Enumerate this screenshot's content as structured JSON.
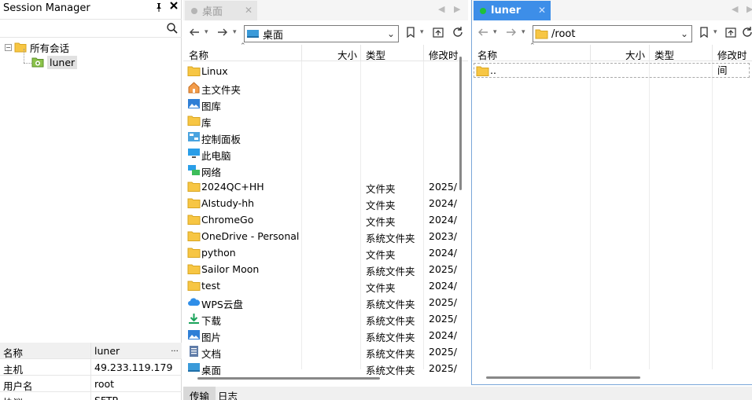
{
  "session_manager": {
    "title": "Session Manager",
    "pin_glyph": "📌",
    "close_glyph": "✕",
    "search_placeholder": "",
    "tree": {
      "root_label": "所有会话",
      "child_label": "luner"
    },
    "properties": [
      {
        "key": "名称",
        "value": "luner"
      },
      {
        "key": "主机",
        "value": "49.233.119.179"
      },
      {
        "key": "用户名",
        "value": "root"
      },
      {
        "key": "协议",
        "value": "SFTP"
      }
    ],
    "prop_more": "..."
  },
  "left_pane": {
    "tab_label": "桌面",
    "address": "桌面",
    "columns": {
      "name": "名称",
      "size": "大小",
      "type": "类型",
      "modified": "修改时"
    },
    "rows": [
      {
        "name": "Linux",
        "type": "",
        "mod": "",
        "icon": "folder-icon"
      },
      {
        "name": "主文件夹",
        "type": "",
        "mod": "",
        "icon": "home-icon"
      },
      {
        "name": "图库",
        "type": "",
        "mod": "",
        "icon": "gallery-icon"
      },
      {
        "name": "库",
        "type": "",
        "mod": "",
        "icon": "folder-icon"
      },
      {
        "name": "控制面板",
        "type": "",
        "mod": "",
        "icon": "control-panel-icon"
      },
      {
        "name": "此电脑",
        "type": "",
        "mod": "",
        "icon": "computer-icon"
      },
      {
        "name": "网络",
        "type": "",
        "mod": "",
        "icon": "network-icon"
      },
      {
        "name": "2024QC+HH",
        "type": "文件夹",
        "mod": "2025/",
        "icon": "folder-icon"
      },
      {
        "name": "AIstudy-hh",
        "type": "文件夹",
        "mod": "2024/",
        "icon": "folder-icon"
      },
      {
        "name": "ChromeGo",
        "type": "文件夹",
        "mod": "2024/",
        "icon": "folder-icon"
      },
      {
        "name": "OneDrive - Personal",
        "type": "系统文件夹",
        "mod": "2023/",
        "icon": "folder-icon"
      },
      {
        "name": "python",
        "type": "文件夹",
        "mod": "2024/",
        "icon": "folder-icon"
      },
      {
        "name": "Sailor Moon",
        "type": "系统文件夹",
        "mod": "2025/",
        "icon": "folder-icon"
      },
      {
        "name": "test",
        "type": "文件夹",
        "mod": "2024/",
        "icon": "folder-icon"
      },
      {
        "name": "WPS云盘",
        "type": "系统文件夹",
        "mod": "2025/",
        "icon": "cloud-icon"
      },
      {
        "name": "下载",
        "type": "系统文件夹",
        "mod": "2025/",
        "icon": "download-icon"
      },
      {
        "name": "图片",
        "type": "系统文件夹",
        "mod": "2024/",
        "icon": "picture-icon"
      },
      {
        "name": "文档",
        "type": "系统文件夹",
        "mod": "2025/",
        "icon": "document-icon"
      },
      {
        "name": "桌面",
        "type": "系统文件夹",
        "mod": "2025/",
        "icon": "desktop-icon"
      }
    ]
  },
  "right_pane": {
    "tab_label": "luner",
    "address": "/root",
    "columns": {
      "name": "名称",
      "size": "大小",
      "type": "类型",
      "modified": "修改时间"
    },
    "rows": [
      {
        "name": ".."
      }
    ]
  },
  "bottom_tabs": {
    "transfer": "传输",
    "log": "日志"
  },
  "colors": {
    "accent": "#3d8ee8",
    "folder": "#f7c644",
    "connected": "#1fc13a"
  }
}
